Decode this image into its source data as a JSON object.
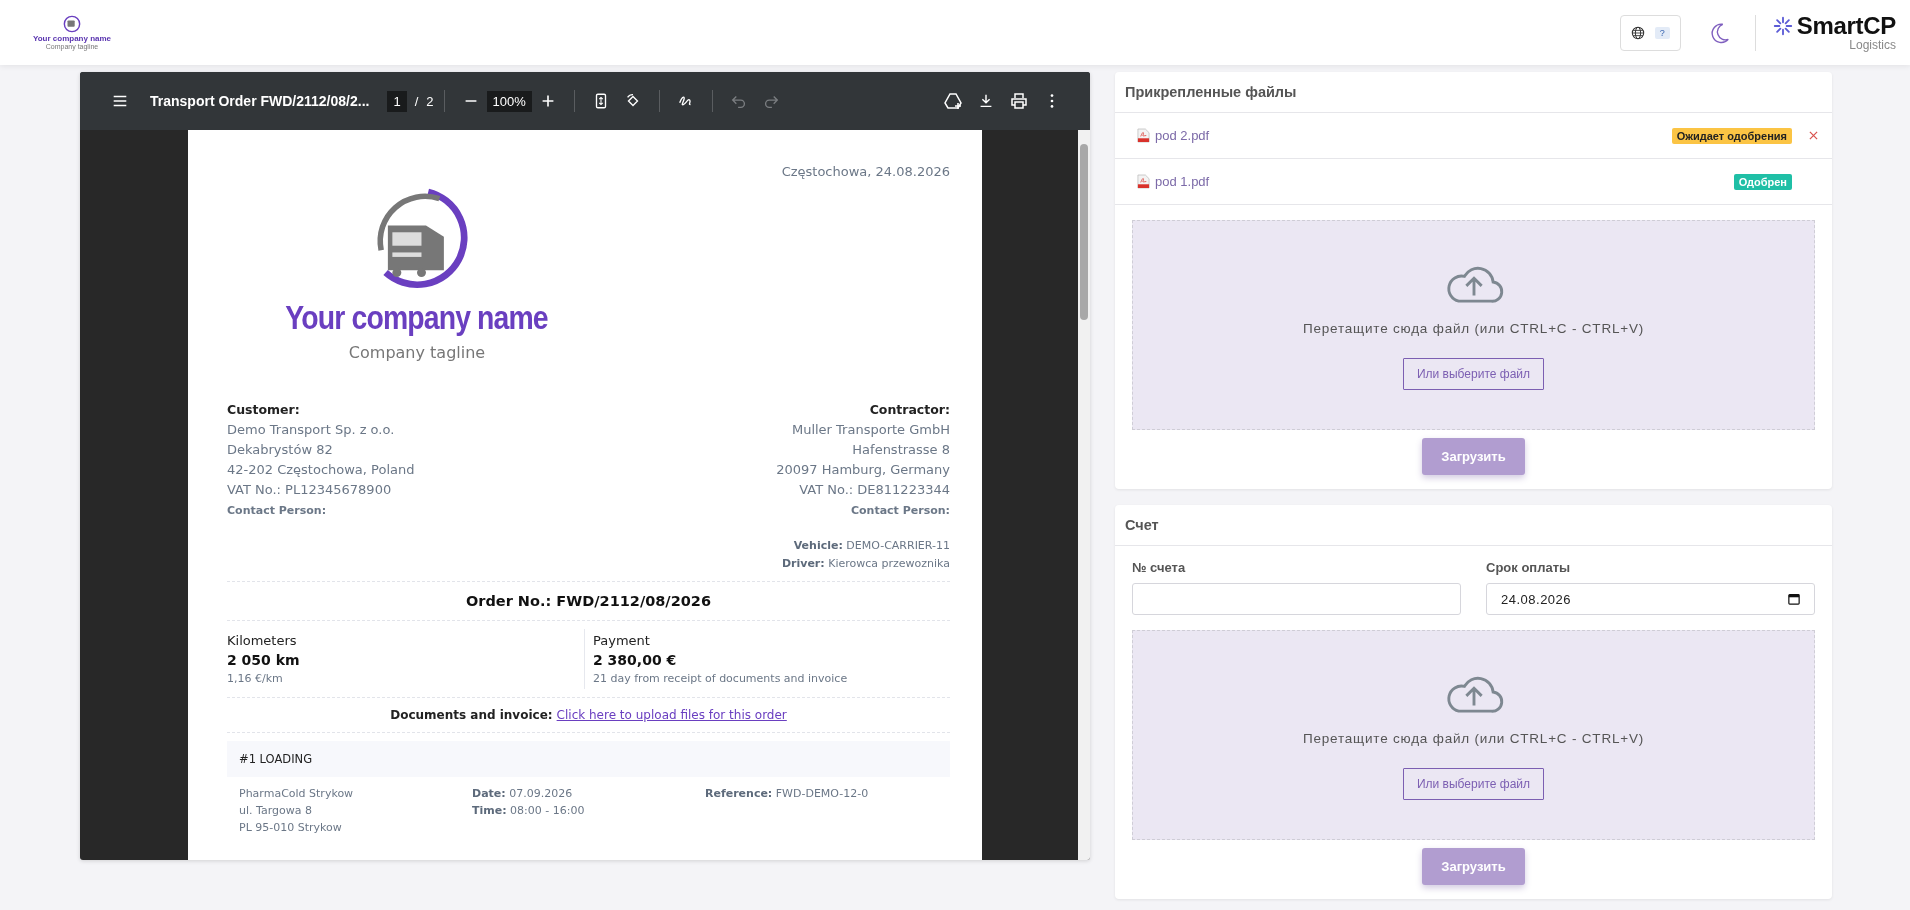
{
  "header": {
    "logo": {
      "name": "Your company name",
      "tagline": "Company tagline"
    },
    "language_badge": "?",
    "brand": {
      "name": "SmartCP",
      "subtitle": "Logistics"
    }
  },
  "viewer": {
    "title": "Transport Order FWD/2112/08/2...",
    "page": "1",
    "separator": "/",
    "page_count": "2",
    "zoom": "100%",
    "undo_disabled": true,
    "redo_disabled": true,
    "document": {
      "place_date": "Częstochowa, 24.08.2026",
      "logo_name": "Your company name",
      "logo_tagline": "Company tagline",
      "parties": [
        {
          "heading": "Customer:",
          "lines": [
            "Demo Transport Sp. z o.o.",
            "Dekabrystów 82",
            "42-202 Częstochowa, Poland",
            "VAT No.: PL12345678900"
          ],
          "contact": "Contact Person:"
        },
        {
          "heading": "Contractor:",
          "lines": [
            "Muller Transporte GmbH",
            "Hafenstrasse 8",
            "20097 Hamburg, Germany",
            "VAT No.: DE811223344"
          ],
          "contact": "Contact Person:"
        }
      ],
      "vehicle": [
        {
          "label": "Vehicle:",
          "value": "DEMO-CARRIER-11"
        },
        {
          "label": "Driver:",
          "value": "Kierowca przewoznika"
        }
      ],
      "order_number": "Order No.: FWD/2112/08/2026",
      "summary": [
        {
          "label": "Kilometers",
          "value": "2 050 km",
          "note": "1,16 €/km"
        },
        {
          "label": "Payment",
          "value": "2 380,00 €",
          "note": "21 day from receipt of documents and invoice"
        }
      ],
      "documents": {
        "label": "Documents and invoice:",
        "link": "Click here to upload files for this order"
      },
      "stop": {
        "heading": "#1 LOADING",
        "address": [
          "PharmaCold Strykow",
          "ul. Targowa 8",
          "PL 95-010 Strykow"
        ],
        "details": [
          {
            "label": "Date:",
            "value": "07.09.2026"
          },
          {
            "label": "Time:",
            "value": "08:00 - 16:00"
          }
        ],
        "reference": {
          "label": "Reference:",
          "value": "FWD-DEMO-12-0"
        }
      }
    }
  },
  "attached_files": {
    "title": "Прикрепленные файлы",
    "files": [
      {
        "name": "pod 2.pdf",
        "status": "Ожидает одобрения",
        "color": "#fbc444",
        "removable": true
      },
      {
        "name": "pod 1.pdf",
        "status": "Одобрен",
        "color": "#1fbfa6",
        "removable": false
      }
    ],
    "dropzone": {
      "hint": "Перетащите сюда файл (или CTRL+C - CTRL+V)",
      "choose": "Или выберите файл"
    },
    "upload": {
      "label": "Загрузить",
      "disabled": true
    }
  },
  "invoice": {
    "title": "Счет",
    "fields": [
      {
        "label": "№ счета",
        "kind": "text"
      },
      {
        "label": "Срок оплаты",
        "kind": "date",
        "value": "24.08.2026"
      }
    ],
    "dropzone": {
      "hint": "Перетащите сюда файл (или CTRL+C - CTRL+V)",
      "choose": "Или выберите файл"
    },
    "upload": {
      "label": "Загрузить",
      "disabled": true
    }
  }
}
